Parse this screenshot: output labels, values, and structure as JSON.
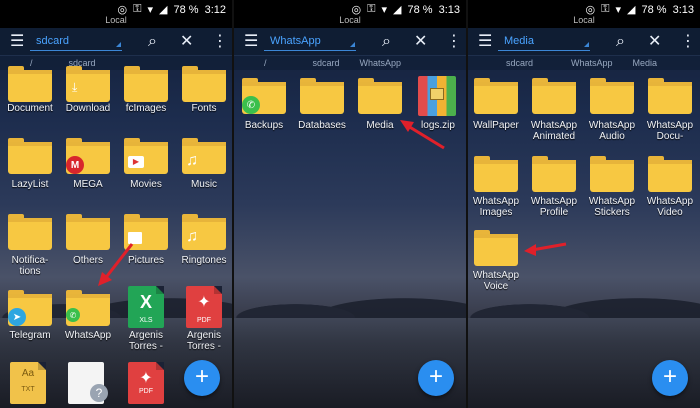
{
  "status": {
    "battery": "78 %",
    "local_label": "Local"
  },
  "panels": [
    {
      "title": "sdcard",
      "time": "3:12",
      "breadcrumb": [
        "/",
        "sdcard"
      ],
      "items": [
        {
          "label": "Document"
        },
        {
          "label": "Download"
        },
        {
          "label": "fcImages"
        },
        {
          "label": "Fonts"
        },
        {
          "label": "LazyList"
        },
        {
          "label": "MEGA"
        },
        {
          "label": "Movies"
        },
        {
          "label": "Music"
        },
        {
          "label": "Notifica-\ntions"
        },
        {
          "label": "Others"
        },
        {
          "label": "Pictures"
        },
        {
          "label": "Ringtones"
        },
        {
          "label": "Telegram"
        },
        {
          "label": "WhatsApp"
        },
        {
          "label": "Argenis\nTorres -"
        },
        {
          "label": "Argenis\nTorres -"
        }
      ]
    },
    {
      "title": "WhatsApp",
      "time": "3:13",
      "breadcrumb": [
        "/",
        "sdcard",
        "WhatsApp"
      ],
      "items": [
        {
          "label": "Backups"
        },
        {
          "label": "Databases"
        },
        {
          "label": "Media"
        },
        {
          "label": "logs.zip"
        }
      ]
    },
    {
      "title": "Media",
      "time": "3:13",
      "breadcrumb": [
        "sdcard",
        "WhatsApp",
        "Media"
      ],
      "items": [
        {
          "label": "WallPaper"
        },
        {
          "label": "WhatsApp\nAnimated"
        },
        {
          "label": "WhatsApp\nAudio"
        },
        {
          "label": "WhatsApp\nDocu-"
        },
        {
          "label": "WhatsApp\nImages"
        },
        {
          "label": "WhatsApp\nProfile"
        },
        {
          "label": "WhatsApp\nStickers"
        },
        {
          "label": "WhatsApp\nVideo"
        },
        {
          "label": "WhatsApp\nVoice"
        }
      ]
    }
  ],
  "file_badges": {
    "xls": "XLS",
    "pdf": "PDF",
    "txt": "TXT"
  },
  "icons": {
    "menu": "☰",
    "search": "⌕",
    "close": "✕",
    "more": "⋮",
    "add": "+",
    "music": "♫",
    "play": "▶"
  },
  "colors": {
    "accent": "#2a8ef0",
    "folder": "#f7c842",
    "toolbar": "#0f1d33",
    "arrow": "#e0202a"
  }
}
